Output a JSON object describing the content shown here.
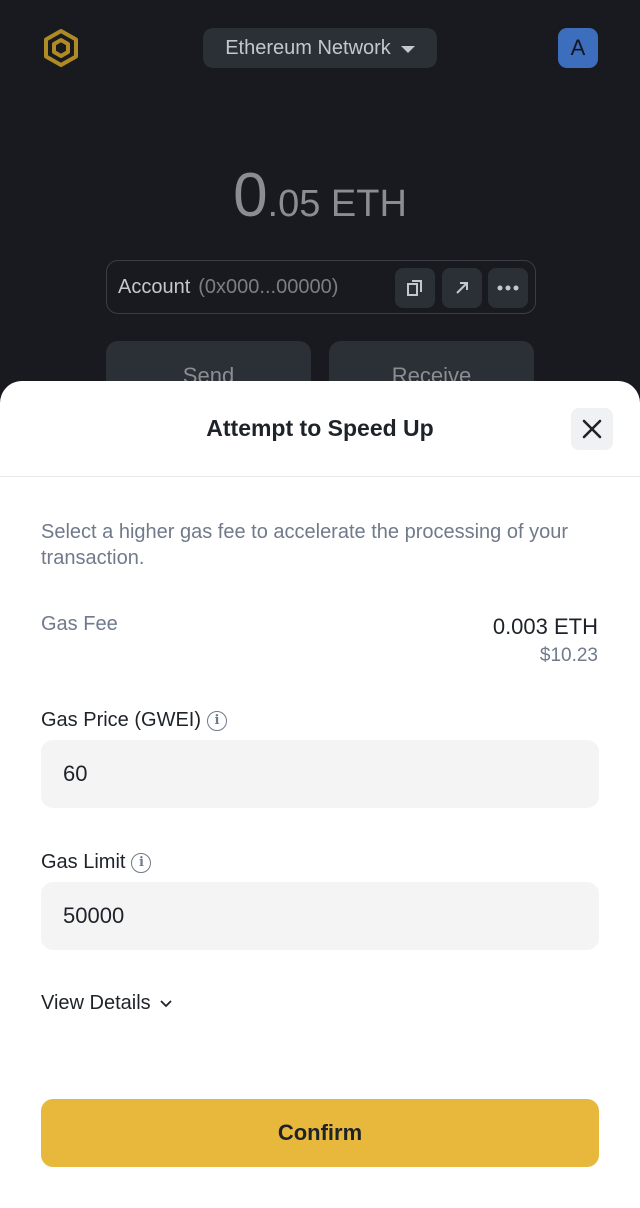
{
  "background": {
    "network_selector": "Ethereum Network",
    "avatar_letter": "A",
    "balance_whole": "0",
    "balance_fraction": ".05 ETH",
    "account_label": "Account",
    "account_address": "(0x000...00000)",
    "send_label": "Send",
    "receive_label": "Receive"
  },
  "sheet": {
    "title": "Attempt to Speed Up",
    "description": "Select a higher gas fee to accelerate the processing of your transaction.",
    "gas_fee_label": "Gas Fee",
    "gas_fee_eth": "0.003 ETH",
    "gas_fee_usd": "$10.23",
    "gas_price_label": "Gas Price (GWEI)",
    "gas_price_value": "60",
    "gas_limit_label": "Gas Limit",
    "gas_limit_value": "50000",
    "view_details_label": "View Details",
    "confirm_label": "Confirm"
  },
  "colors": {
    "accent": "#e8b83d",
    "avatar": "#3d6ebd"
  }
}
